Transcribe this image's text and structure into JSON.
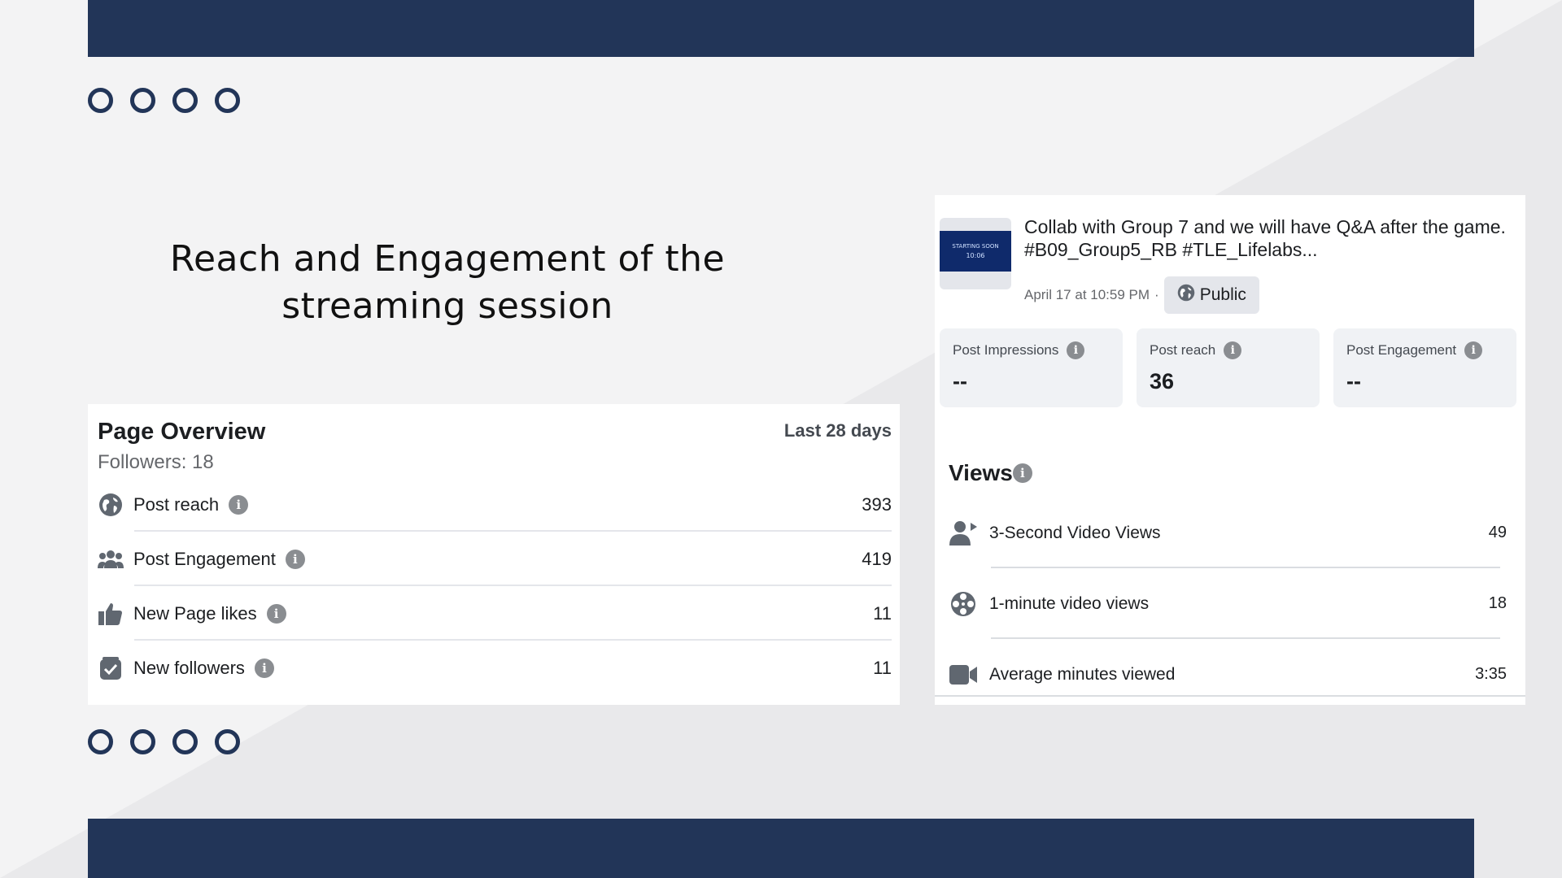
{
  "colors": {
    "navy": "#223558",
    "background": "#f3f3f4",
    "panel": "#ffffff",
    "icon_gray": "#606770"
  },
  "slide": {
    "title": "Reach and Engagement of the streaming session"
  },
  "overview": {
    "title": "Page Overview",
    "followers": "Followers: 18",
    "range": "Last 28 days",
    "rows": [
      {
        "icon": "globe-icon",
        "label": "Post reach",
        "value": "393"
      },
      {
        "icon": "people-icon",
        "label": "Post Engagement",
        "value": "419"
      },
      {
        "icon": "thumbs-up-icon",
        "label": "New Page likes",
        "value": "11"
      },
      {
        "icon": "checkbox-icon",
        "label": "New followers",
        "value": "11"
      }
    ]
  },
  "post": {
    "thumbnail": {
      "line1": "STARTING SOON",
      "line2": "10:06"
    },
    "text": "Collab with Group 7 and we will have Q&A after the game. #B09_Group5_RB #TLE_Lifelabs...",
    "date": "April 17 at 10:59 PM",
    "separator": "·",
    "visibility": "Public",
    "stats": [
      {
        "label": "Post Impressions",
        "value": "--"
      },
      {
        "label": "Post reach",
        "value": "36"
      },
      {
        "label": "Post Engagement",
        "value": "--"
      }
    ],
    "views": {
      "title": "Views",
      "rows": [
        {
          "icon": "person-play-icon",
          "label": "3-Second Video Views",
          "value": "49"
        },
        {
          "icon": "film-reel-icon",
          "label": "1-minute video views",
          "value": "18"
        },
        {
          "icon": "video-camera-icon",
          "label": "Average minutes viewed",
          "value": "3:35"
        }
      ]
    }
  },
  "info_glyph": "i"
}
